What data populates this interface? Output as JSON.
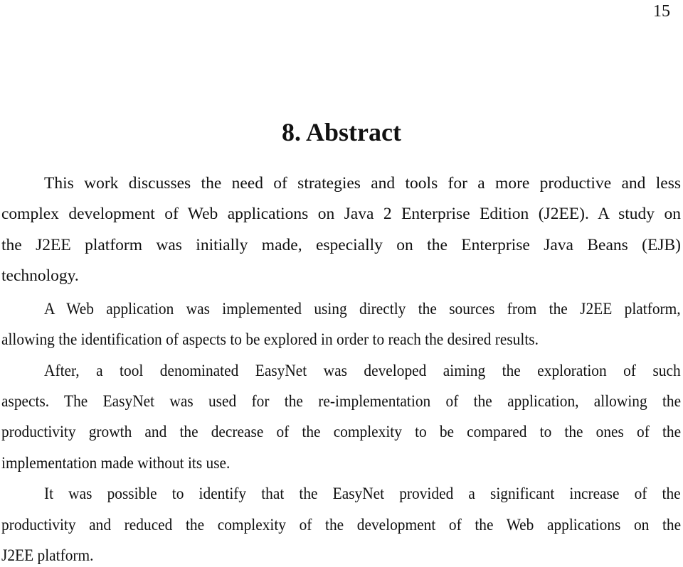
{
  "page": {
    "number": "15"
  },
  "section": {
    "title": "8. Abstract"
  },
  "paragraphs": [
    {
      "lines": [
        "This work discusses the need of strategies and tools for a more productive and less",
        "complex development of Web applications on Java 2 Enterprise Edition (J2EE). A study on",
        "the J2EE platform was initially made, especially on the Enterprise Java Beans (EJB)",
        "technology."
      ]
    },
    {
      "lines": [
        "A Web application was implemented using directly the sources from the J2EE platform,",
        "allowing the identification of aspects to be explored in order to reach the desired results."
      ]
    },
    {
      "lines": [
        "After, a tool denominated EasyNet was developed aiming the exploration of such",
        "aspects. The EasyNet was used for the re-implementation of the application, allowing the",
        "productivity growth and the decrease of the complexity to be compared to the ones of the",
        "implementation made without its use."
      ]
    },
    {
      "lines": [
        "It was possible to identify that the EasyNet provided a significant increase of the",
        "productivity and reduced the complexity of the development of the Web applications on the",
        "J2EE platform."
      ]
    }
  ]
}
